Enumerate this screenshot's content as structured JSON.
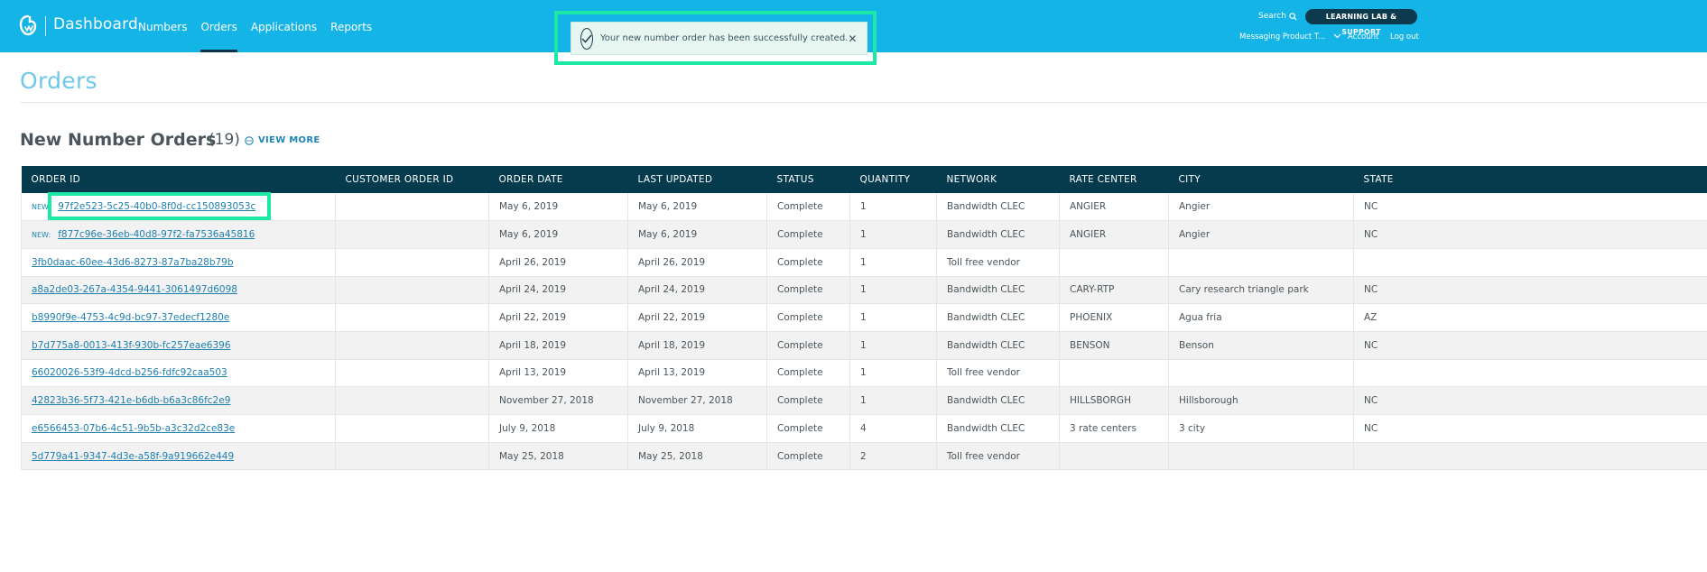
{
  "header": {
    "brand": "Dashboard",
    "nav": [
      "Numbers",
      "Orders",
      "Applications",
      "Reports"
    ],
    "active_nav": "Orders",
    "search_label": "Search",
    "support_label": "LEARNING LAB & SUPPORT",
    "account_selector": "Messaging Product T...",
    "account_link": "Account",
    "logout_link": "Log out"
  },
  "toast": {
    "message": "Your new number order has been successfully created."
  },
  "page": {
    "title": "Orders",
    "section_title": "New Number Orders",
    "section_count": "(19)",
    "view_more": "VIEW MORE"
  },
  "table": {
    "columns": [
      "ORDER ID",
      "CUSTOMER ORDER ID",
      "ORDER DATE",
      "LAST UPDATED",
      "STATUS",
      "QUANTITY",
      "NETWORK",
      "RATE CENTER",
      "CITY",
      "STATE"
    ],
    "new_tag": "NEW:",
    "rows": [
      {
        "new": true,
        "order_id": "97f2e523-5c25-40b0-8f0d-cc150893053c",
        "customer_order_id": "",
        "order_date": "May 6, 2019",
        "last_updated": "May 6, 2019",
        "status": "Complete",
        "quantity": "1",
        "network": "Bandwidth CLEC",
        "rate_center": "ANGIER",
        "city": "Angier",
        "state": "NC"
      },
      {
        "new": true,
        "order_id": "f877c96e-36eb-40d8-97f2-fa7536a45816",
        "customer_order_id": "",
        "order_date": "May 6, 2019",
        "last_updated": "May 6, 2019",
        "status": "Complete",
        "quantity": "1",
        "network": "Bandwidth CLEC",
        "rate_center": "ANGIER",
        "city": "Angier",
        "state": "NC"
      },
      {
        "new": false,
        "order_id": "3fb0daac-60ee-43d6-8273-87a7ba28b79b",
        "customer_order_id": "",
        "order_date": "April 26, 2019",
        "last_updated": "April 26, 2019",
        "status": "Complete",
        "quantity": "1",
        "network": "Toll free vendor",
        "rate_center": "",
        "city": "",
        "state": ""
      },
      {
        "new": false,
        "order_id": "a8a2de03-267a-4354-9441-3061497d6098",
        "customer_order_id": "",
        "order_date": "April 24, 2019",
        "last_updated": "April 24, 2019",
        "status": "Complete",
        "quantity": "1",
        "network": "Bandwidth CLEC",
        "rate_center": "CARY-RTP",
        "city": "Cary research triangle park",
        "state": "NC"
      },
      {
        "new": false,
        "order_id": "b8990f9e-4753-4c9d-bc97-37edecf1280e",
        "customer_order_id": "",
        "order_date": "April 22, 2019",
        "last_updated": "April 22, 2019",
        "status": "Complete",
        "quantity": "1",
        "network": "Bandwidth CLEC",
        "rate_center": "PHOENIX",
        "city": "Agua fria",
        "state": "AZ"
      },
      {
        "new": false,
        "order_id": "b7d775a8-0013-413f-930b-fc257eae6396",
        "customer_order_id": "",
        "order_date": "April 18, 2019",
        "last_updated": "April 18, 2019",
        "status": "Complete",
        "quantity": "1",
        "network": "Bandwidth CLEC",
        "rate_center": "BENSON",
        "city": "Benson",
        "state": "NC"
      },
      {
        "new": false,
        "order_id": "66020026-53f9-4dcd-b256-fdfc92caa503",
        "customer_order_id": "",
        "order_date": "April 13, 2019",
        "last_updated": "April 13, 2019",
        "status": "Complete",
        "quantity": "1",
        "network": "Toll free vendor",
        "rate_center": "",
        "city": "",
        "state": ""
      },
      {
        "new": false,
        "order_id": "42823b36-5f73-421e-b6db-b6a3c86fc2e9",
        "customer_order_id": "",
        "order_date": "November 27, 2018",
        "last_updated": "November 27, 2018",
        "status": "Complete",
        "quantity": "1",
        "network": "Bandwidth CLEC",
        "rate_center": "HILLSBORGH",
        "city": "Hillsborough",
        "state": "NC"
      },
      {
        "new": false,
        "order_id": "e6566453-07b6-4c51-9b5b-a3c32d2ce83e",
        "customer_order_id": "",
        "order_date": "July 9, 2018",
        "last_updated": "July 9, 2018",
        "status": "Complete",
        "quantity": "4",
        "network": "Bandwidth CLEC",
        "rate_center": "3 rate centers",
        "city": "3 city",
        "state": "NC"
      },
      {
        "new": false,
        "order_id": "5d779a41-9347-4d3e-a58f-9a919662e449",
        "customer_order_id": "",
        "order_date": "May 25, 2018",
        "last_updated": "May 25, 2018",
        "status": "Complete",
        "quantity": "2",
        "network": "Toll free vendor",
        "rate_center": "",
        "city": "",
        "state": ""
      }
    ]
  }
}
